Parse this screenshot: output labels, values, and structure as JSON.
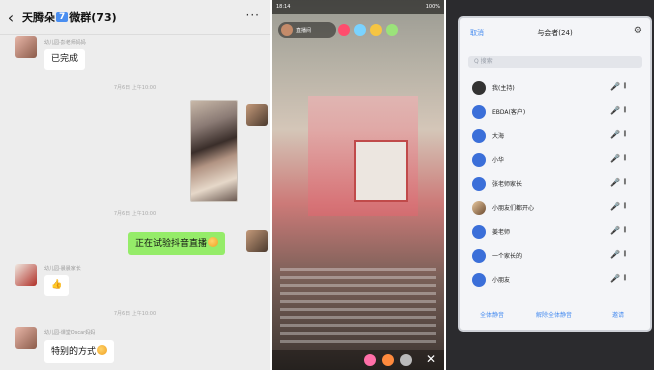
{
  "chat": {
    "title_prefix": "天腾朵",
    "title_tag": "7",
    "title_suffix": "微群(73)",
    "more": "···",
    "messages": [
      {
        "sender": "幼儿园-彭老师妈妈",
        "text": "已完成"
      },
      {
        "time": "7月6日 上午10:00"
      },
      {
        "type": "image"
      },
      {
        "time": "7月6日 上午10:00"
      },
      {
        "text": "正在试验抖音直播"
      },
      {
        "sender": "幼儿园-晨晨家长",
        "text": "👍"
      },
      {
        "time": "7月6日 上午10:00"
      },
      {
        "sender": "幼儿园-课堂Oscar妈妈",
        "text": "特别的方式"
      }
    ]
  },
  "live": {
    "status_left": "18:14",
    "status_right": "100%",
    "host_label": "直播间"
  },
  "tablet": {
    "cancel": "取消",
    "title": "与会者(24)",
    "search_placeholder": "Q 搜索",
    "members": [
      {
        "name": "我(主持)",
        "mic_on": true
      },
      {
        "name": "EBDA(客户)"
      },
      {
        "name": "大海"
      },
      {
        "name": "小华"
      },
      {
        "name": "张老师家长"
      },
      {
        "name": "小朋友们都开心"
      },
      {
        "name": "姜老师"
      },
      {
        "name": "一个家长的"
      },
      {
        "name": "小朋友"
      }
    ],
    "footer": [
      "全体静音",
      "解除全体静音",
      "邀请"
    ]
  }
}
